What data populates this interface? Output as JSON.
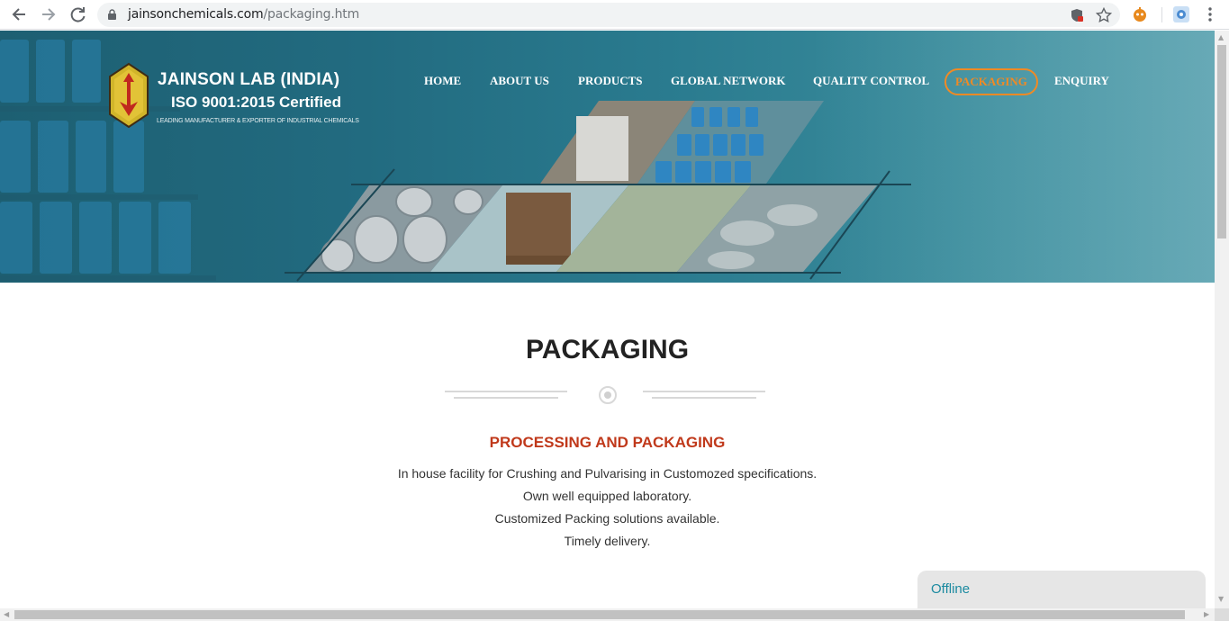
{
  "browser": {
    "back_icon": "arrow-left-icon",
    "forward_icon": "arrow-right-icon",
    "reload_icon": "reload-icon",
    "url_host": "jainsonchemicals.com",
    "url_path": "/packaging.htm"
  },
  "brand": {
    "title": "JAINSON LAB (INDIA)",
    "iso": "ISO 9001:2015 Certified",
    "tagline": "LEADING MANUFACTURER & EXPORTER OF INDUSTRIAL CHEMICALS"
  },
  "nav": {
    "items": [
      {
        "label": "HOME"
      },
      {
        "label": "ABOUT US"
      },
      {
        "label": "PRODUCTS"
      },
      {
        "label": "GLOBAL NETWORK"
      },
      {
        "label": "QUALITY CONTROL"
      },
      {
        "label": "PACKAGING",
        "active": true
      },
      {
        "label": "ENQUIRY"
      }
    ],
    "active_color": "#f08a24"
  },
  "main": {
    "title": "PACKAGING",
    "section_title": "PROCESSING AND PACKAGING",
    "lines": [
      "In house facility for Crushing and Pulvarising in Customozed specifications.",
      "Own well equipped laboratory.",
      "Customized Packing solutions available.",
      "Timely delivery."
    ],
    "accent_color": "#c0391b"
  },
  "chat": {
    "status": "Offline"
  }
}
